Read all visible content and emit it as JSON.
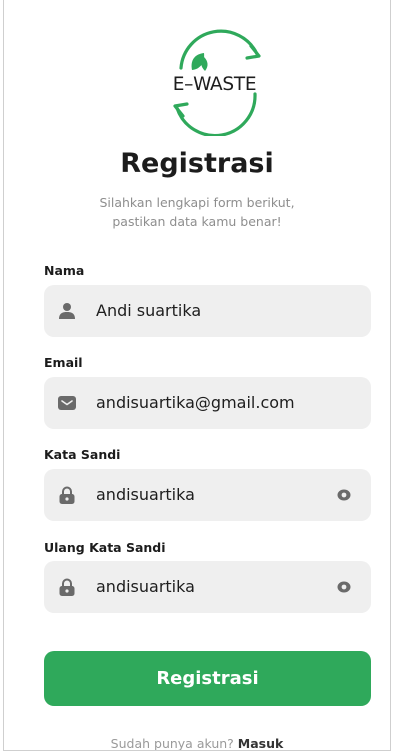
{
  "logo": {
    "text": "E–WASTE"
  },
  "header": {
    "title": "Registrasi",
    "subtitle_line1": "Silahkan lengkapi form berikut,",
    "subtitle_line2": "pastikan data kamu benar!"
  },
  "form": {
    "name": {
      "label": "Nama",
      "value": "Andi suartika",
      "icon": "user-icon"
    },
    "email": {
      "label": "Email",
      "value": "andisuartika@gmail.com",
      "icon": "envelope-icon"
    },
    "password": {
      "label": "Kata Sandi",
      "value": "andisuartika",
      "icon": "lock-icon"
    },
    "confirm": {
      "label": "Ulang Kata Sandi",
      "value": "andisuartika",
      "icon": "lock-icon"
    }
  },
  "submit_label": "Registrasi",
  "footer": {
    "prompt": "Sudah punya akun?",
    "link": "Masuk"
  },
  "colors": {
    "accent": "#2fa95b",
    "field_bg": "#efefef",
    "icon": "#6a6a6a"
  }
}
